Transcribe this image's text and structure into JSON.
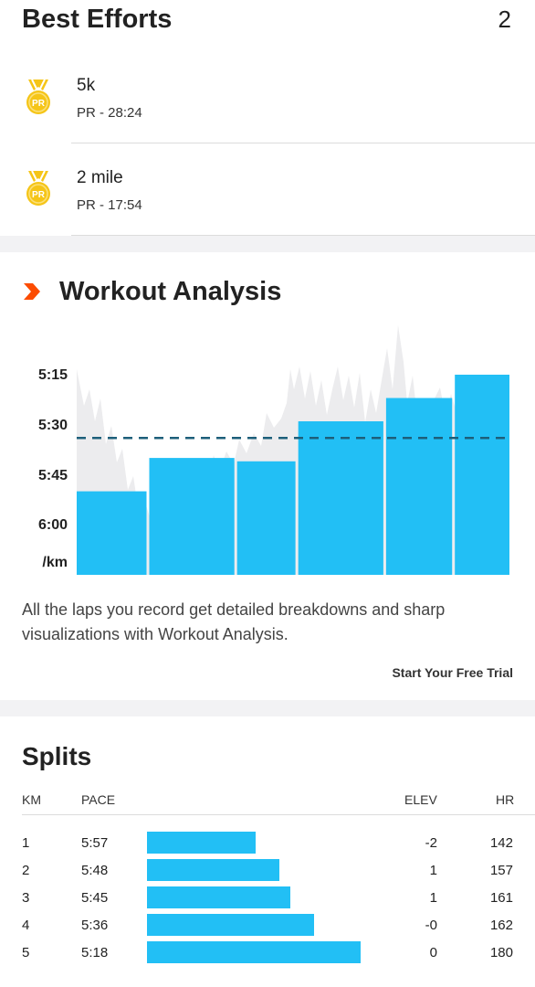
{
  "best_efforts": {
    "title": "Best Efforts",
    "count": "2",
    "items": [
      {
        "name": "5k",
        "pr": "PR - 28:24",
        "badge": "PR"
      },
      {
        "name": "2 mile",
        "pr": "PR - 17:54",
        "badge": "PR"
      }
    ]
  },
  "workout_analysis": {
    "title": "Workout Analysis",
    "y_labels": [
      "5:15",
      "5:30",
      "5:45",
      "6:00",
      "/km"
    ],
    "description": "All the laps you record get detailed breakdowns and sharp visualizations with Workout Analysis.",
    "cta": "Start Your Free Trial",
    "colors": {
      "bar": "#22bff5",
      "hr_area": "#ececee",
      "avg_line": "#1d5f7a",
      "chevron": "#fc4c02"
    }
  },
  "chart_data": {
    "type": "bar",
    "ylabel": "/km",
    "y_ticks": [
      "5:15",
      "5:30",
      "5:45",
      "6:00"
    ],
    "laps": [
      {
        "pace_sec": 350,
        "width_share": 0.19
      },
      {
        "pace_sec": 340,
        "width_share": 0.23
      },
      {
        "pace_sec": 341,
        "width_share": 0.16
      },
      {
        "pace_sec": 329,
        "width_share": 0.23
      },
      {
        "pace_sec": 322,
        "width_share": 0.18
      },
      {
        "pace_sec": 315,
        "width_share": 0.15
      }
    ],
    "average_pace_sec": 334
  },
  "splits": {
    "title": "Splits",
    "headers": {
      "km": "KM",
      "pace": "PACE",
      "elev": "ELEV",
      "hr": "HR"
    },
    "rows": [
      {
        "km": "1",
        "pace": "5:57",
        "elev": "-2",
        "hr": "142",
        "bar_fraction": 0.51
      },
      {
        "km": "2",
        "pace": "5:48",
        "elev": "1",
        "hr": "157",
        "bar_fraction": 0.62
      },
      {
        "km": "3",
        "pace": "5:45",
        "elev": "1",
        "hr": "161",
        "bar_fraction": 0.67
      },
      {
        "km": "4",
        "pace": "5:36",
        "elev": "-0",
        "hr": "162",
        "bar_fraction": 0.78
      },
      {
        "km": "5",
        "pace": "5:18",
        "elev": "0",
        "hr": "180",
        "bar_fraction": 1.0
      }
    ]
  }
}
